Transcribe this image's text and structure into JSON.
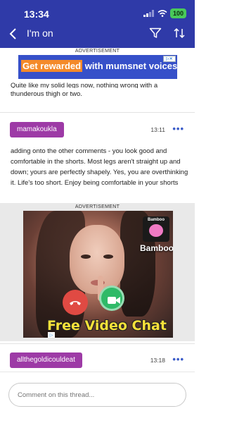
{
  "status_bar": {
    "time": "13:34",
    "battery": "100"
  },
  "header": {
    "title": "I'm on",
    "back_icon": "chevron-left-icon",
    "filter_icon": "filter-icon",
    "sort_icon": "sort-arrows-icon",
    "color": "#2f3aa8"
  },
  "top_ad": {
    "label": "ADVERTISEMENT",
    "highlight": "Get rewarded",
    "rest": " with mumsnet voices"
  },
  "previous_post": {
    "line1": "Quite like my solid legs now, nothing wrong with a",
    "line2": "thunderous thigh or two."
  },
  "posts": [
    {
      "username": "mamakoukla",
      "time": "13:11",
      "body": "adding onto the other comments - you look good and comfortable in the shorts. Most legs aren't straight up and down; yours are perfectly shapely. Yes, you are overthinking it. Life's too short. Enjoy being comfortable in your shorts"
    },
    {
      "username": "allthegoldicouldeat",
      "time": "13:18"
    }
  ],
  "mid_ad": {
    "label": "ADVERTISEMENT",
    "brand_logo_text": "Bamboo",
    "brand": "Bamboo",
    "cta": "Free Video Chat"
  },
  "comment": {
    "placeholder": "Comment on this thread..."
  },
  "colors": {
    "accent": "#2f3aa8",
    "username_badge": "#9d3aa6",
    "menu_dots": "#3b5cc9"
  }
}
